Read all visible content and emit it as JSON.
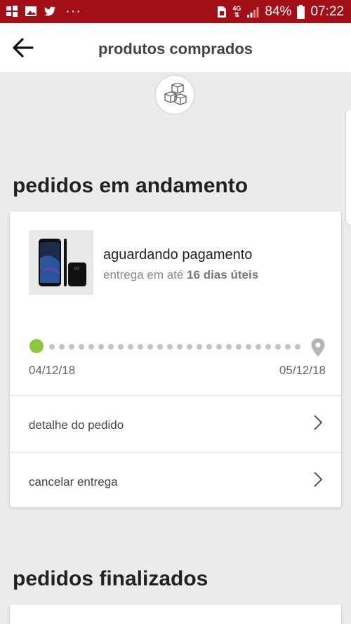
{
  "status_bar": {
    "network": "4G",
    "battery": "84%",
    "time": "07:22",
    "bg_color": "#a30f16"
  },
  "app_bar": {
    "title": "produtos comprados",
    "back_icon": "arrow-left-icon"
  },
  "badge_icon": "boxes-icon",
  "sections": {
    "in_progress": "pedidos em andamento",
    "finished": "pedidos finalizados"
  },
  "order": {
    "status": "aguardando pagamento",
    "delivery_prefix": "entrega em até",
    "delivery_days": "16 dias úteis",
    "start_date": "04/12/18",
    "end_date": "05/12/18",
    "progress": 0,
    "start_color": "#8dc63f",
    "actions": [
      {
        "label": "detalhe do pedido"
      },
      {
        "label": "cancelar entrega"
      }
    ]
  }
}
